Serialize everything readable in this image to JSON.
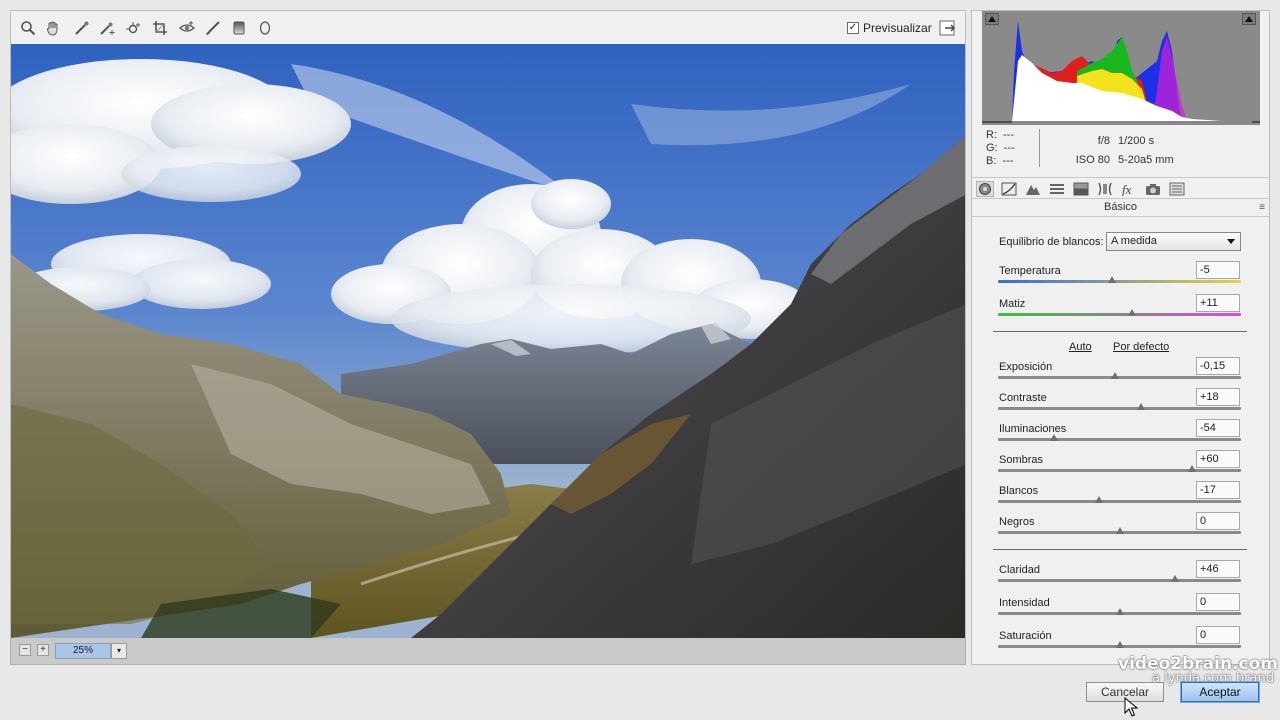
{
  "toolbar": {
    "tools": [
      "zoom-tool",
      "hand-tool",
      "white-balance-tool",
      "color-sampler-tool",
      "targeted-adjustment-tool",
      "crop-tool",
      "straighten-tool",
      "red-eye-tool",
      "adjustment-brush-tool",
      "graduated-filter-tool"
    ],
    "preview_checked": "✓",
    "preview_label": "Previsualizar"
  },
  "zoom": {
    "minus": "−",
    "plus": "+",
    "value": "25%",
    "dropdown": "▾"
  },
  "histogram": {
    "rgb": [
      {
        "label": "R:",
        "value": "---"
      },
      {
        "label": "G:",
        "value": "---"
      },
      {
        "label": "B:",
        "value": "---"
      }
    ],
    "aperture": "f/8",
    "shutter": "1/200 s",
    "iso": "ISO 80",
    "focal": "5-20a5 mm"
  },
  "panel": {
    "title": "Básico",
    "menu_icon": "≡",
    "wb_label": "Equilibrio de blancos:",
    "wb_value": "A medida",
    "auto_label": "Auto",
    "default_label": "Por defecto"
  },
  "sliders": [
    {
      "key": "temperatura",
      "label": "Temperatura",
      "value": "-5",
      "level": 0.47
    },
    {
      "key": "matiz",
      "label": "Matiz",
      "value": "+11",
      "level": 0.55
    },
    {
      "key": "exposicion",
      "label": "Exposición",
      "value": "-0,15",
      "level": 0.48
    },
    {
      "key": "contraste",
      "label": "Contraste",
      "value": "+18",
      "level": 0.59
    },
    {
      "key": "iluminaciones",
      "label": "Iluminaciones",
      "value": "-54",
      "level": 0.23
    },
    {
      "key": "sombras",
      "label": "Sombras",
      "value": "+60",
      "level": 0.8
    },
    {
      "key": "blancos",
      "label": "Blancos",
      "value": "-17",
      "level": 0.415
    },
    {
      "key": "negros",
      "label": "Negros",
      "value": "0",
      "level": 0.5
    },
    {
      "key": "claridad",
      "label": "Claridad",
      "value": "+46",
      "level": 0.73
    },
    {
      "key": "intensidad",
      "label": "Intensidad",
      "value": "0",
      "level": 0.5
    },
    {
      "key": "saturacion",
      "label": "Saturación",
      "value": "0",
      "level": 0.5
    }
  ],
  "buttons": {
    "cancel": "Cancelar",
    "accept": "Aceptar"
  },
  "watermark": {
    "main": "video2brain.com",
    "sub": "a lynda.com brand"
  },
  "colors": {
    "accent": "#9cc4ef",
    "histogram_bg": "#8a8a8a"
  }
}
